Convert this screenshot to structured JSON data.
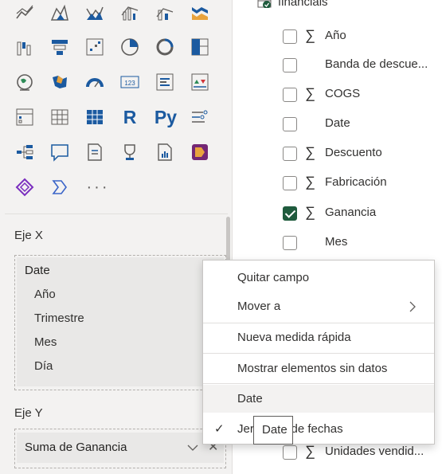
{
  "visualizations": {
    "rows": [
      [
        "line-chart-icon",
        "area-chart-icon",
        "stacked-area-chart-icon",
        "line-clustered-column-icon",
        "line-stacked-column-icon",
        "ribbon-chart-icon"
      ],
      [
        "waterfall-chart-icon",
        "funnel-chart-icon",
        "scatter-chart-icon",
        "pie-chart-icon",
        "donut-chart-icon",
        "treemap-icon"
      ],
      [
        "map-icon",
        "filled-map-icon",
        "gauge-icon",
        "card-icon",
        "multi-row-card-icon",
        "kpi-icon"
      ],
      [
        "slicer-icon",
        "table-icon",
        "matrix-icon",
        "r-visual-icon",
        "python-visual-icon",
        "key-influencers-icon"
      ],
      [
        "decomposition-tree-icon",
        "qa-icon",
        "smart-narrative-icon",
        "goals-icon",
        "paginated-report-icon",
        "power-apps-icon"
      ],
      [
        "power-automate-icon",
        "more-visuals-icon",
        "more-options-icon"
      ]
    ],
    "r_label": "R",
    "py_label": "Py",
    "more_label": "···"
  },
  "wells": {
    "x_axis": {
      "label": "Eje X",
      "field": "Date",
      "hierarchy": [
        "Año",
        "Trimestre",
        "Mes",
        "Día"
      ]
    },
    "y_axis": {
      "label": "Eje Y",
      "field": "Suma de Ganancia",
      "remove": "✕"
    }
  },
  "fields": {
    "table_name": "financials",
    "items": [
      {
        "label": "Año",
        "sigma": true,
        "checked": false
      },
      {
        "label": "Banda de descue...",
        "sigma": false,
        "checked": false
      },
      {
        "label": "COGS",
        "sigma": true,
        "checked": false
      },
      {
        "label": "Date",
        "sigma": false,
        "checked": false
      },
      {
        "label": "Descuento",
        "sigma": true,
        "checked": false
      },
      {
        "label": "Fabricación",
        "sigma": true,
        "checked": false
      },
      {
        "label": "Ganancia",
        "sigma": true,
        "checked": true
      },
      {
        "label": "Mes",
        "sigma": false,
        "checked": false
      }
    ],
    "bottom_item": {
      "label": "Unidades vendid...",
      "sigma": true,
      "checked": false
    },
    "sigma_symbol": "∑"
  },
  "context_menu": {
    "items": [
      {
        "label": "Quitar campo"
      },
      {
        "label": "Mover a"
      },
      {
        "label": "Nueva medida rápida"
      },
      {
        "label": "Mostrar elementos sin datos"
      },
      {
        "label": "Date"
      },
      {
        "label": "Jerarquía de fechas"
      }
    ],
    "check": "✓"
  },
  "tooltip": {
    "text": "Date"
  },
  "colors": {
    "accent_green": "#1f5b3d",
    "pane_bg": "#f3f2f1",
    "chart_blue": "#1b5aa0"
  }
}
